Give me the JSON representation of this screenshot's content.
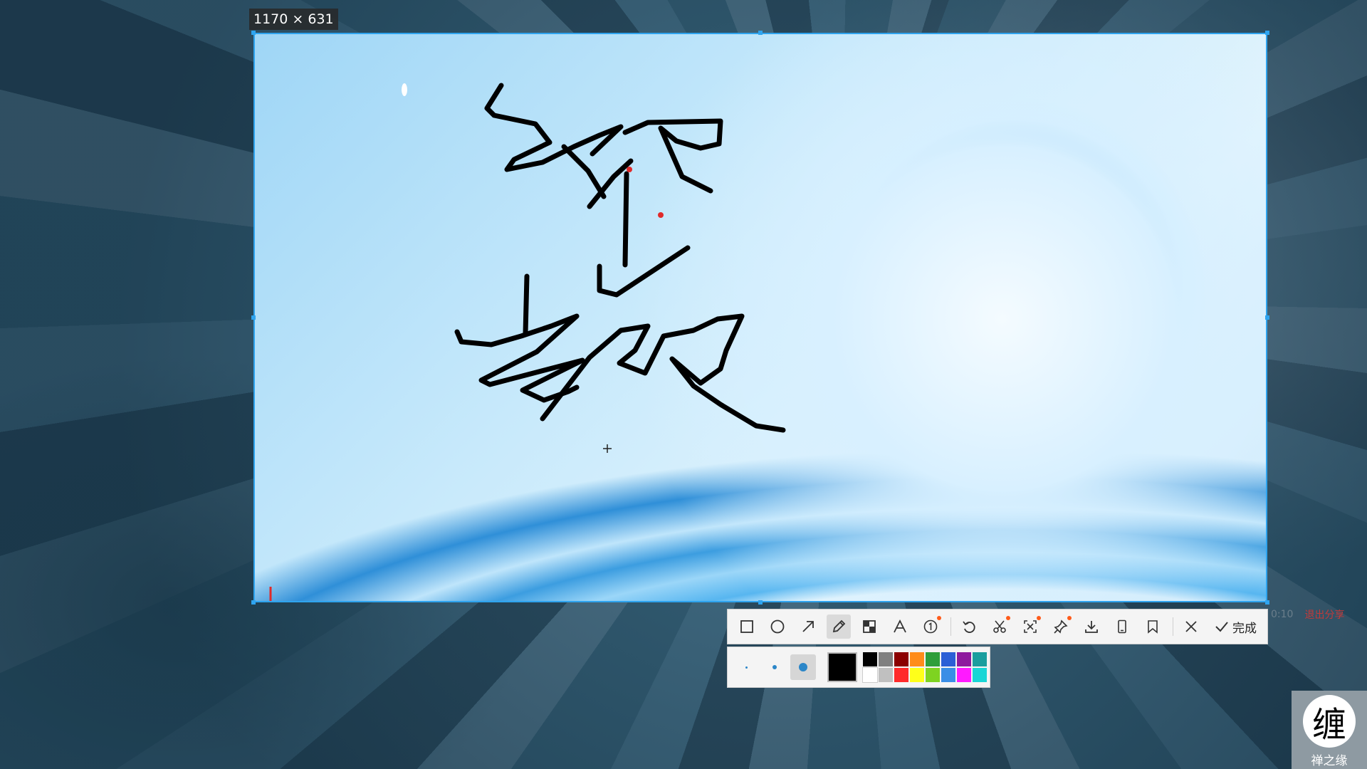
{
  "selection": {
    "size_label": "1170 × 631",
    "border_color": "#2fa4ef"
  },
  "toolbar": {
    "tools": [
      {
        "name": "rectangle-tool",
        "icon": "square-icon"
      },
      {
        "name": "ellipse-tool",
        "icon": "circle-icon"
      },
      {
        "name": "arrow-tool",
        "icon": "arrow-icon"
      },
      {
        "name": "pen-tool",
        "icon": "pencil-icon",
        "active": true
      },
      {
        "name": "mosaic-tool",
        "icon": "mosaic-icon"
      },
      {
        "name": "text-tool",
        "icon": "text-a-icon"
      },
      {
        "name": "number-marker-tool",
        "icon": "number-circle-icon",
        "badge": true
      },
      {
        "name": "undo-button",
        "icon": "undo-icon"
      },
      {
        "name": "long-screenshot-button",
        "icon": "scissors-icon",
        "badge": true
      },
      {
        "name": "ocr-button",
        "icon": "scan-icon",
        "badge": true
      },
      {
        "name": "pin-button",
        "icon": "pin-icon",
        "badge": true
      },
      {
        "name": "save-button",
        "icon": "download-icon"
      },
      {
        "name": "phone-button",
        "icon": "phone-icon"
      },
      {
        "name": "bookmark-button",
        "icon": "bookmark-icon"
      },
      {
        "name": "close-button",
        "icon": "close-icon"
      }
    ],
    "finish_label": "完成"
  },
  "subbar": {
    "brush_sizes": [
      "small",
      "medium",
      "large"
    ],
    "active_brush": "large",
    "current_color": "#000000",
    "palette": [
      "#000000",
      "#808080",
      "#8b0000",
      "#ff8c1a",
      "#2e9e3a",
      "#2b5fd6",
      "#8e1a9e",
      "#1a9e9e",
      "#ffffff",
      "#c0c0c0",
      "#ff2a2a",
      "#ffff1a",
      "#7ed321",
      "#3a8ee6",
      "#ff1aff",
      "#1ad6d6"
    ]
  },
  "background_app": {
    "timer_text": "0:10",
    "exit_share_label": "退出分享"
  },
  "watermark": {
    "glyph": "缠",
    "text": "禅之缘"
  }
}
